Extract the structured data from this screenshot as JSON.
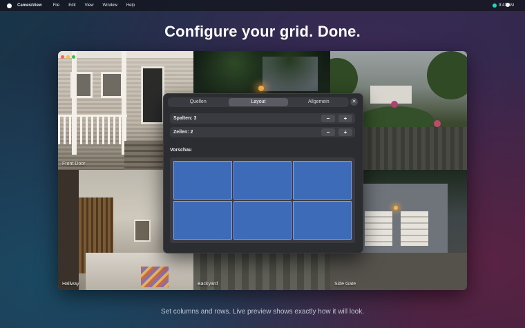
{
  "menubar": {
    "app_name": "CameraView",
    "items": [
      "File",
      "Edit",
      "View",
      "Window",
      "Help"
    ],
    "clock": "9:41 AM"
  },
  "headline": "Configure your grid. Done.",
  "caption": "Set columns and rows. Live preview shows exactly how it will look.",
  "cameras": [
    {
      "label": "Front Door"
    },
    {
      "label": ""
    },
    {
      "label": ""
    },
    {
      "label": "Hallway"
    },
    {
      "label": "Backyard"
    },
    {
      "label": "Side Gate"
    }
  ],
  "panel": {
    "tabs": [
      {
        "label": "Quellen",
        "active": false
      },
      {
        "label": "Layout",
        "active": true
      },
      {
        "label": "Allgemein",
        "active": false
      }
    ],
    "close_glyph": "✕",
    "columns": {
      "label": "Spalten: 3",
      "value": 3
    },
    "rows": {
      "label": "Zeilen: 2",
      "value": 2
    },
    "minus_glyph": "−",
    "plus_glyph": "+",
    "preview_title": "Vorschau",
    "cell_color": "#3e6bb8"
  },
  "colors": {
    "status_dot": "#2ad1c0",
    "accent_blue": "#3e6bb8"
  }
}
